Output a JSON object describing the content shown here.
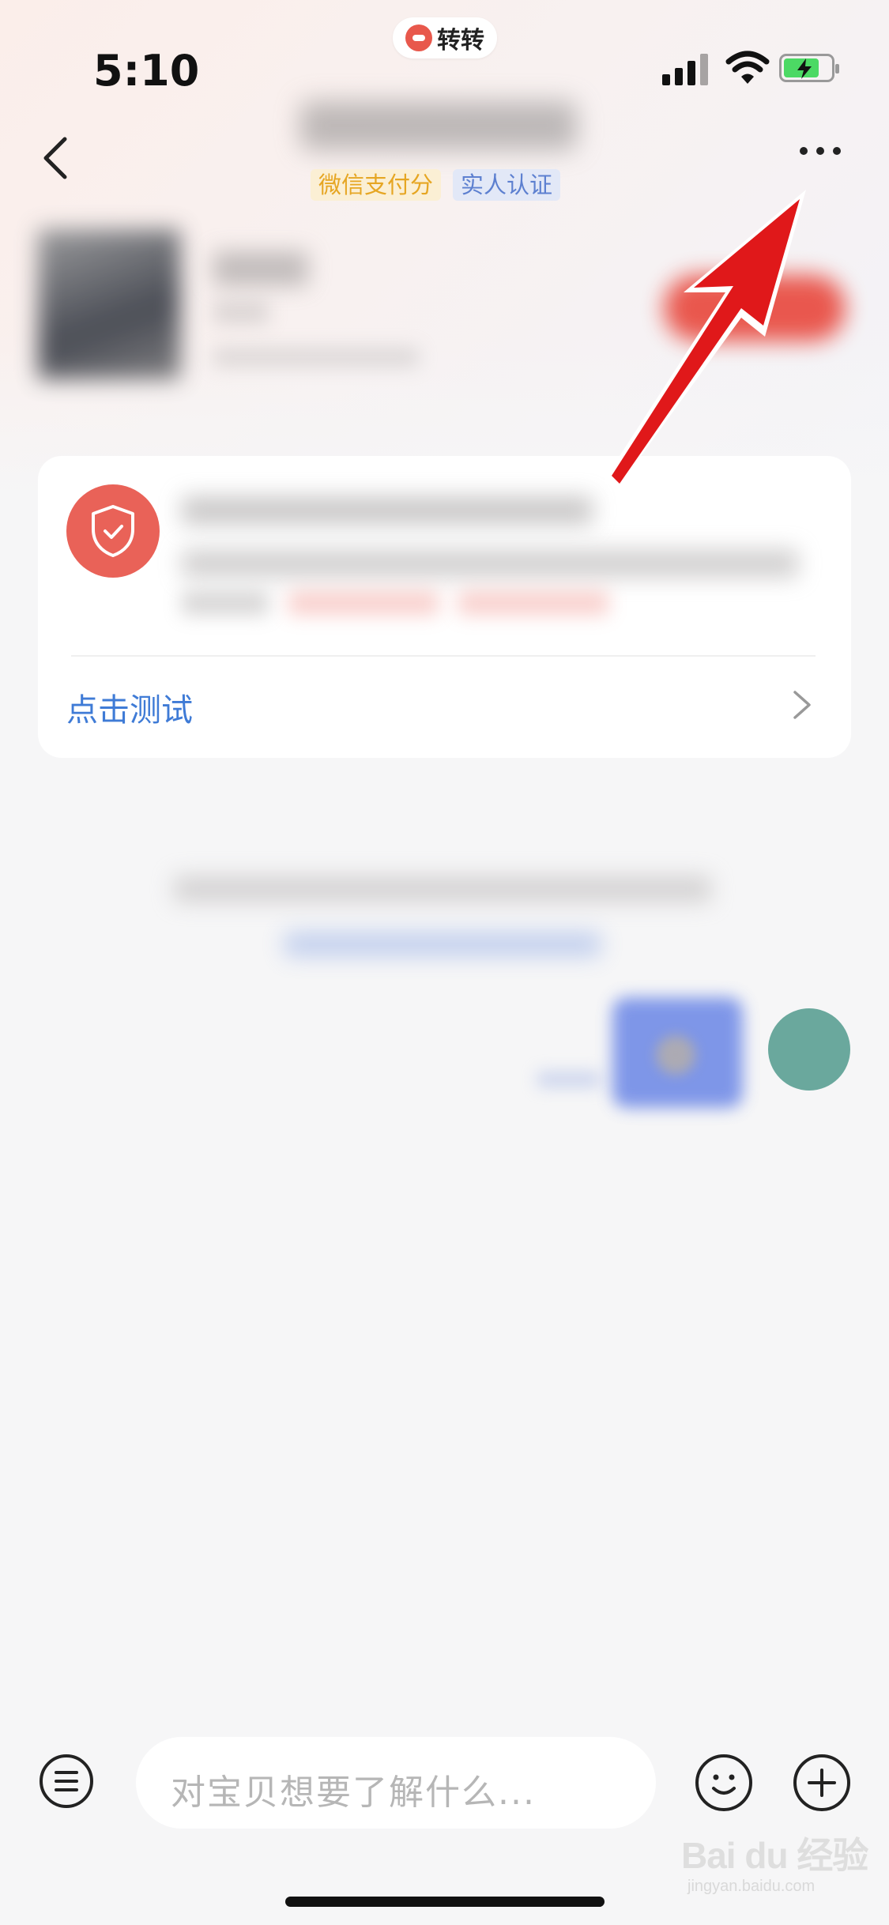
{
  "status_bar": {
    "time": "5:10",
    "app_name": "转转"
  },
  "header": {
    "tags": [
      "微信支付分",
      "实人认证"
    ],
    "icons": [
      "chevron-left-icon",
      "more-horizontal-icon"
    ]
  },
  "test_card": {
    "link_label": "点击测试",
    "icons": [
      "shield-check-icon",
      "chevron-right-icon"
    ]
  },
  "input_bar": {
    "placeholder": "对宝贝想要了解什么...",
    "icons": [
      "menu-icon",
      "emoji-icon",
      "plus-icon"
    ]
  },
  "colors": {
    "accent_red": "#e96258",
    "link_blue": "#3f7bd6",
    "tag_wechat": "#e6a623",
    "tag_verify": "#5d80d0",
    "avatar": "#6aa89d"
  },
  "watermark": {
    "text": "Bai du 经验",
    "url": "jingyan.baidu.com"
  }
}
